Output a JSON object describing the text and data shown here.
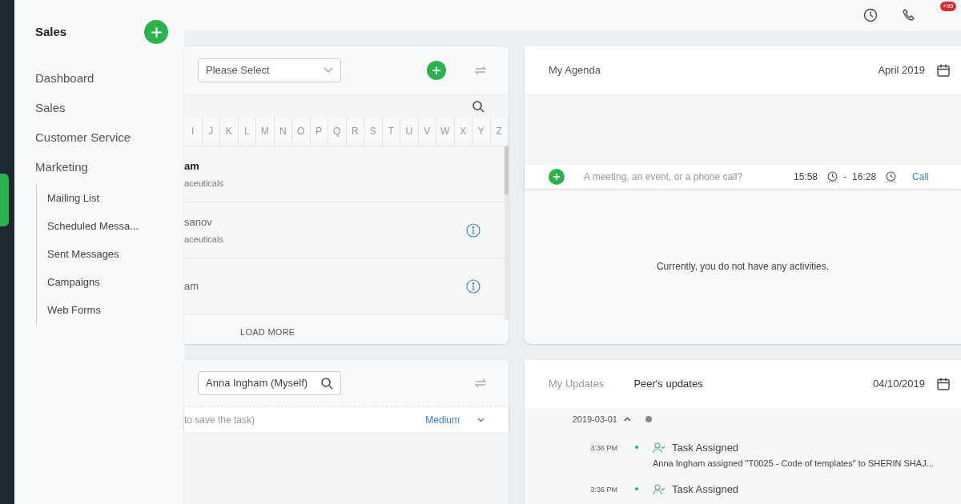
{
  "topbar": {
    "notification_badge": "+99"
  },
  "sidebar": {
    "title": "Sales",
    "items": [
      {
        "label": "Dashboard"
      },
      {
        "label": "Sales"
      },
      {
        "label": "Customer Service"
      },
      {
        "label": "Marketing",
        "expanded": true,
        "children": [
          {
            "label": "Mailing List"
          },
          {
            "label": "Scheduled Messa..."
          },
          {
            "label": "Sent Messages"
          },
          {
            "label": "Campaigns"
          },
          {
            "label": "Web Forms"
          }
        ]
      }
    ]
  },
  "contacts_card": {
    "select": {
      "placeholder": "Please Select"
    },
    "alphabet": [
      "I",
      "J",
      "K",
      "L",
      "M",
      "N",
      "O",
      "P",
      "Q",
      "R",
      "S",
      "T",
      "U",
      "V",
      "W",
      "X",
      "Y",
      "Z"
    ],
    "rows": [
      {
        "name": "am",
        "company": "aceuticals",
        "unread": true,
        "info": false
      },
      {
        "name": "sanov",
        "company": "aceuticals",
        "unread": false,
        "info": true
      },
      {
        "name": "am",
        "unread": false,
        "info": true
      }
    ],
    "load_more": "LOAD MORE"
  },
  "agenda": {
    "title": "My Agenda",
    "month": "April 2019",
    "new_activity": {
      "placeholder": "A meeting, an event, or a phone call?",
      "start": "15:58",
      "separator": "-",
      "end": "16:28",
      "type": "Call"
    },
    "empty_message": "Currently, you do not have any activities."
  },
  "tasks_card": {
    "assignee": "Anna Ingham (Myself)",
    "hint": "to save the task)",
    "priority": "Medium"
  },
  "updates": {
    "tabs": [
      {
        "label": "My Updates",
        "selected": false
      },
      {
        "label": "Peer's updates",
        "selected": true
      }
    ],
    "date": "04/10/2019",
    "groups": [
      {
        "date": "2019-03-01",
        "expanded": true,
        "entries": [
          {
            "time": "3:36 PM",
            "title": "Task Assigned",
            "detail": "Anna Ingham assigned \"T0025 - Code of templates\" to SHERIN SHAJ..."
          },
          {
            "time": "3:36 PM",
            "title": "Task Assigned"
          }
        ]
      }
    ]
  }
}
